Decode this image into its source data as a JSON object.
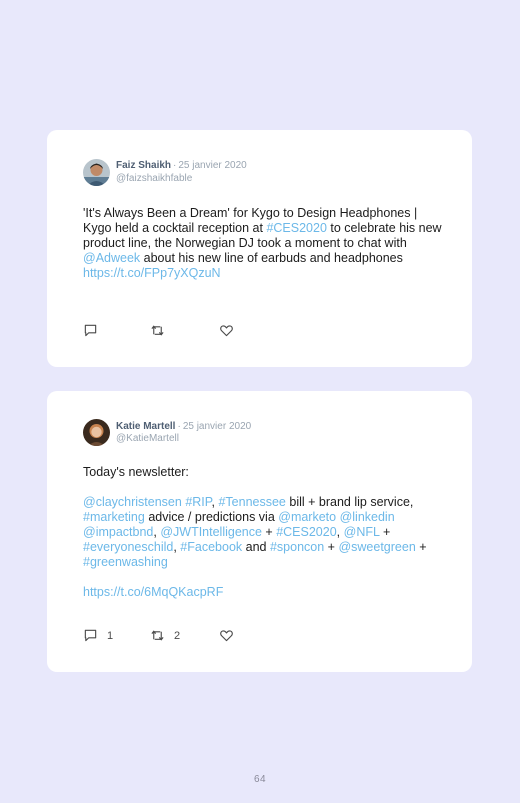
{
  "tweets": [
    {
      "name": "Faiz Shaikh",
      "separator": "·",
      "date": "25 janvier 2020",
      "handle": "@faizshaikhfable",
      "text": {
        "t1": "'It's Always Been a Dream' for Kygo to Design Headphones | Kygo held a cocktail reception at ",
        "tag1": "#CES2020",
        "t2": " to celebrate his new product line, the Norwegian DJ took a moment to chat with ",
        "mention1": "@Adweek",
        "t3": " about his new line of earbuds and headphones",
        "link": "https://t.co/FPp7yXQzuN"
      },
      "reply_icon": "reply-icon",
      "retweet_icon": "retweet-icon",
      "like_icon": "heart-icon"
    },
    {
      "name": "Katie Martell",
      "separator": "·",
      "date": "25 janvier 2020",
      "handle": "@KatieMartell",
      "text": {
        "intro": "Today's newsletter:",
        "m1": "@claychristensen",
        "tRip": "#RIP",
        "c1": ", ",
        "tTn": "#Tennessee",
        "c2": " bill + brand lip service, ",
        "tMk": "#marketing",
        "c3": " advice / predictions via ",
        "m2": "@marketo",
        "m3": "@linkedin",
        "m4": "@impactbnd",
        "c4": ", ",
        "m5": "@JWTIntelligence",
        "c5": " + ",
        "tCes": "#CES2020",
        "c6": ", ",
        "m6": "@NFL",
        "c7": " + ",
        "tEc": "#everyoneschild",
        "c8": ", ",
        "tFb": "#Facebook",
        "c9": " and ",
        "tSp": "#sponcon",
        "c10": " +",
        "m7": "@sweetgreen",
        "c11": " + ",
        "tGw": "#greenwashing",
        "link": "https://t.co/6MqQKacpRF"
      },
      "reply_count": "1",
      "retweet_count": "2",
      "reply_icon": "reply-icon",
      "retweet_icon": "retweet-icon",
      "like_icon": "heart-icon"
    }
  ],
  "page_number": "64",
  "colors": {
    "background": "#e8e8fb",
    "link": "#6cb8e8",
    "name": "#4f5f73",
    "meta": "#9aa5b1"
  }
}
